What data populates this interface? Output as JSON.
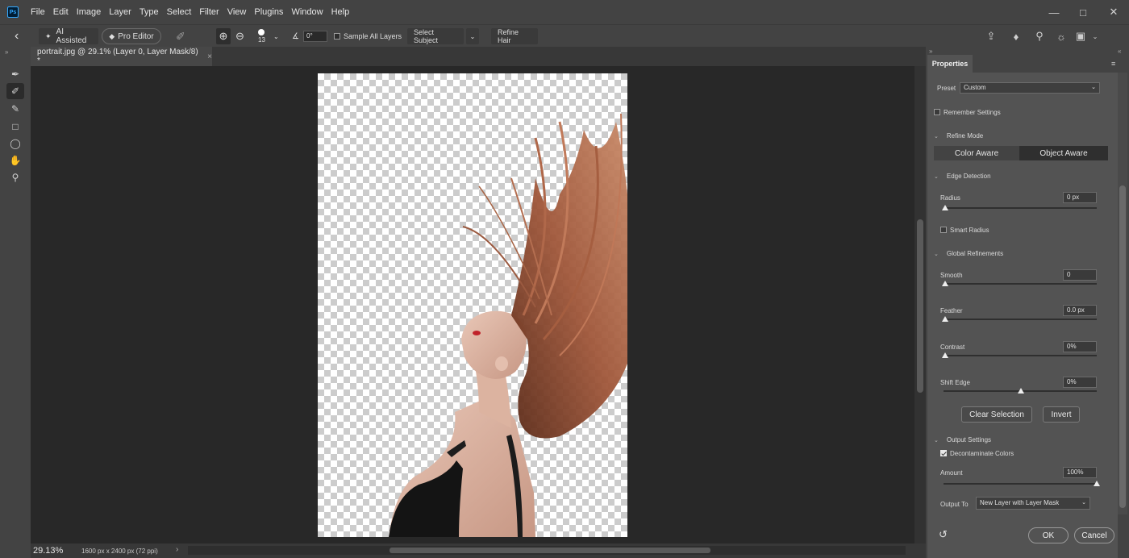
{
  "app": {
    "logo_text": "Ps"
  },
  "menu": [
    "File",
    "Edit",
    "Image",
    "Layer",
    "Type",
    "Select",
    "Filter",
    "View",
    "Plugins",
    "Window",
    "Help"
  ],
  "options": {
    "ai_assisted_label": "AI Assisted",
    "pro_editor_label": "Pro Editor",
    "brush_size": "13",
    "angle_value": "0°",
    "sample_all_layers_label": "Sample All Layers",
    "select_subject_label": "Select Subject",
    "refine_hair_label": "Refine Hair"
  },
  "document": {
    "tab_title": "portrait.jpg @ 29.1% (Layer 0, Layer Mask/8) *",
    "zoom": "29.13%",
    "doc_size": "1600 px x 2400 px (72 ppi)"
  },
  "properties": {
    "tab_label": "Properties",
    "preset_label": "Preset",
    "preset_value": "Custom",
    "remember_settings_label": "Remember Settings",
    "refine_mode_label": "Refine Mode",
    "color_aware_label": "Color Aware",
    "object_aware_label": "Object Aware",
    "edge_detection_label": "Edge Detection",
    "radius_label": "Radius",
    "radius_value": "0 px",
    "smart_radius_label": "Smart Radius",
    "global_refinements_label": "Global Refinements",
    "smooth_label": "Smooth",
    "smooth_value": "0",
    "feather_label": "Feather",
    "feather_value": "0.0 px",
    "contrast_label": "Contrast",
    "contrast_value": "0%",
    "shift_edge_label": "Shift Edge",
    "shift_edge_value": "0%",
    "clear_selection_label": "Clear Selection",
    "invert_label": "Invert",
    "output_settings_label": "Output Settings",
    "decontaminate_label": "Decontaminate Colors",
    "amount_label": "Amount",
    "amount_value": "100%",
    "output_to_label": "Output To",
    "output_to_value": "New Layer with Layer Mask",
    "ok_label": "OK",
    "cancel_label": "Cancel"
  }
}
